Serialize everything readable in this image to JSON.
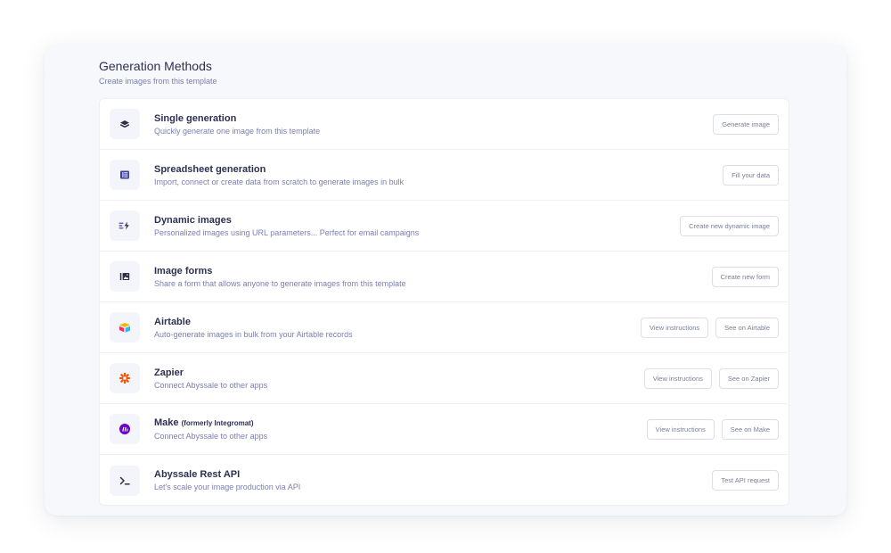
{
  "header": {
    "title": "Generation Methods",
    "subtitle": "Create images from this template"
  },
  "rows": [
    {
      "icon": "layers-icon",
      "title": "Single generation",
      "title_suffix": "",
      "description": "Quickly generate one image from this template",
      "buttons": [
        "Generate image"
      ]
    },
    {
      "icon": "spreadsheet-icon",
      "title": "Spreadsheet generation",
      "title_suffix": "",
      "description": "Import, connect or create data from scratch to generate images in bulk",
      "buttons": [
        "Fill your data"
      ]
    },
    {
      "icon": "dynamic-bolt-icon",
      "title": "Dynamic images",
      "title_suffix": "",
      "description": "Personalized images using URL parameters... Perfect for email campaigns",
      "buttons": [
        "Create new dynamic image"
      ]
    },
    {
      "icon": "image-form-icon",
      "title": "Image forms",
      "title_suffix": "",
      "description": "Share a form that allows anyone to generate images from this template",
      "buttons": [
        "Create new form"
      ]
    },
    {
      "icon": "airtable-logo-icon",
      "title": "Airtable",
      "title_suffix": "",
      "description": "Auto-generate images in bulk from your Airtable records",
      "buttons": [
        "View instructions",
        "See on Airtable"
      ]
    },
    {
      "icon": "zapier-logo-icon",
      "title": "Zapier",
      "title_suffix": "",
      "description": "Connect Abyssale to other apps",
      "buttons": [
        "View instructions",
        "See on Zapier"
      ]
    },
    {
      "icon": "make-logo-icon",
      "title": "Make",
      "title_suffix": "(formerly Integromat)",
      "description": "Connect Abyssale to other apps",
      "buttons": [
        "View instructions",
        "See on Make"
      ]
    },
    {
      "icon": "terminal-icon",
      "title": "Abyssale Rest API",
      "title_suffix": "",
      "description": "Let's scale your image production via API",
      "buttons": [
        "Test API request"
      ]
    }
  ],
  "colors": {
    "accent": "#3b3f9e",
    "zapier": "#ff4a00",
    "make": "#6d00cc",
    "airtable_yellow": "#fcb400",
    "airtable_blue": "#18bfff",
    "airtable_red": "#f82b60"
  }
}
